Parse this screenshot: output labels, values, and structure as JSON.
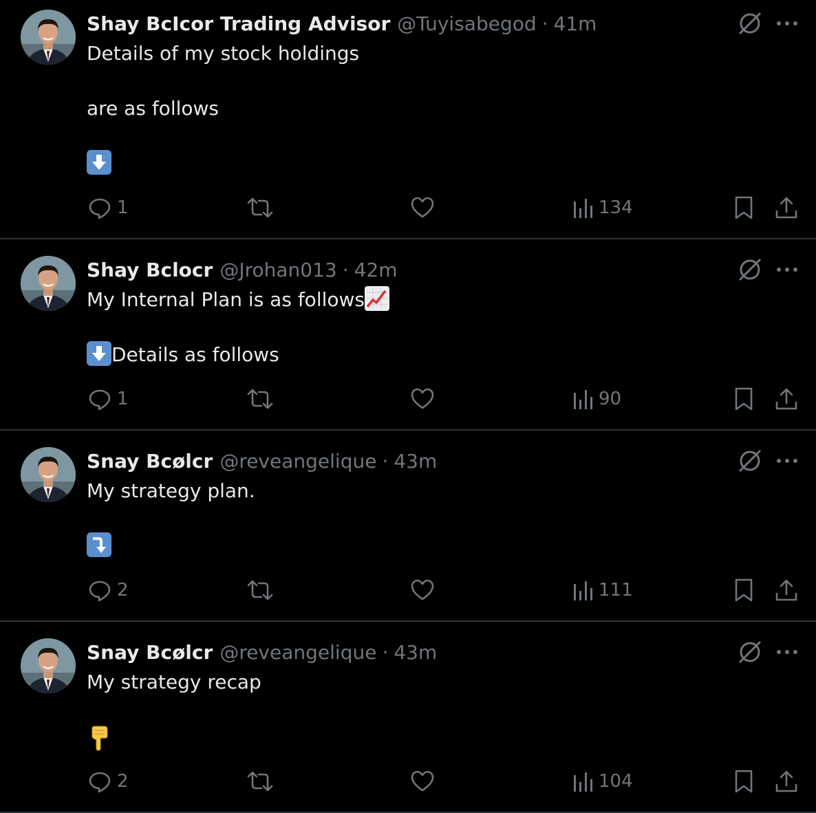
{
  "tweets": [
    {
      "name": "Shay BcIcor Trading Advisor",
      "handle": "@Tuyisabegod",
      "separator": "·",
      "time": "41m",
      "lines": [
        "Details of my stock holdings",
        "are as follows"
      ],
      "emoji": "arrow-down-emoji",
      "reply_count": "1",
      "view_count": "134"
    },
    {
      "name": "Shay Bclocr",
      "handle": "@Jrohan013",
      "separator": "·",
      "time": "42m",
      "lines": [
        "My Internal Plan is as follows",
        "Details as follows"
      ],
      "emoji": "chart-increasing-emoji",
      "reply_count": "1",
      "view_count": "90"
    },
    {
      "name": "Snay Bcølcr",
      "handle": "@reveangelique",
      "separator": "·",
      "time": "43m",
      "lines": [
        "My strategy plan."
      ],
      "emoji": "arrow-curve-down-emoji",
      "reply_count": "2",
      "view_count": "111"
    },
    {
      "name": "Snay Bcølcr",
      "handle": "@reveangelique",
      "separator": "·",
      "time": "43m",
      "lines": [
        "My strategy recap"
      ],
      "emoji": "pointing-down-hand-emoji",
      "reply_count": "2",
      "view_count": "104"
    }
  ],
  "icons": {
    "reply": "reply-icon",
    "retweet": "retweet-icon",
    "like": "like-icon",
    "views": "views-icon",
    "bookmark": "bookmark-icon",
    "share": "share-icon",
    "grok": "grok-icon",
    "more": "more-icon"
  },
  "colors": {
    "background": "#000000",
    "text": "#e7e9ea",
    "secondary": "#71767b",
    "divider": "#2f3336",
    "emoji_blue": "#5b8fd0"
  }
}
